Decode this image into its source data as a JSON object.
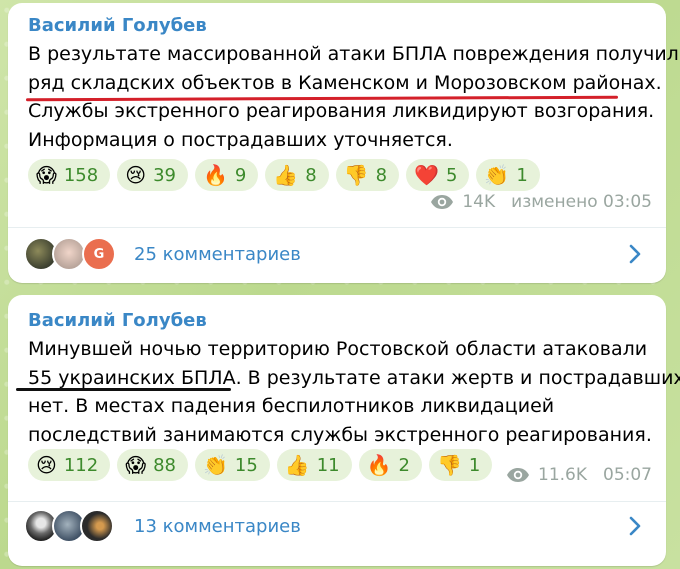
{
  "posts": [
    {
      "author": "Василий Голубев",
      "text_lines": [
        "В результате массированной атаки БПЛА повреждения получил",
        "ряд складских объектов в Каменском и Морозовском районах.",
        "Службы экстренного реагирования ликвидируют возгорания.",
        "Информация о пострадавших уточняется."
      ],
      "reactions": [
        {
          "icon": "screaming-face-icon",
          "emoji": "😱",
          "count": "158"
        },
        {
          "icon": "crying-face-icon",
          "emoji": "😢",
          "count": "39"
        },
        {
          "icon": "fire-icon",
          "emoji": "🔥",
          "count": "9"
        },
        {
          "icon": "thumbs-up-icon",
          "emoji": "👍",
          "count": "8"
        },
        {
          "icon": "thumbs-down-icon",
          "emoji": "👎",
          "count": "8"
        },
        {
          "icon": "red-heart-icon",
          "emoji": "❤️",
          "count": "5"
        },
        {
          "icon": "clapping-hands-icon",
          "emoji": "👏",
          "count": "1"
        }
      ],
      "views": "14K",
      "timestamp": "изменено 03:05",
      "comments": "25 комментариев",
      "avatar_letter": "G"
    },
    {
      "author": "Василий Голубев",
      "text_lines": [
        "Минувшей ночью территорию Ростовской области атаковали",
        "55 украинских БПЛА.  В результате атаки жертв и пострадавших",
        "нет. В местах падения беспилотников ликвидацией",
        "последствий занимаются службы экстренного реагирования."
      ],
      "reactions": [
        {
          "icon": "crying-face-icon",
          "emoji": "😢",
          "count": "112"
        },
        {
          "icon": "screaming-face-icon",
          "emoji": "😱",
          "count": "88"
        },
        {
          "icon": "clapping-hands-icon",
          "emoji": "👏",
          "count": "15"
        },
        {
          "icon": "thumbs-up-icon",
          "emoji": "👍",
          "count": "11"
        },
        {
          "icon": "fire-icon",
          "emoji": "🔥",
          "count": "2"
        },
        {
          "icon": "thumbs-down-icon",
          "emoji": "👎",
          "count": "1"
        }
      ],
      "views": "11.6K",
      "timestamp": "05:07",
      "comments": "13 комментариев"
    }
  ],
  "colors": {
    "accent": "#3a87c6",
    "reaction_bg": "#e7f2da",
    "reaction_count": "#3d8a2c",
    "red_underline": "#d4202a",
    "black_underline": "#111111"
  }
}
